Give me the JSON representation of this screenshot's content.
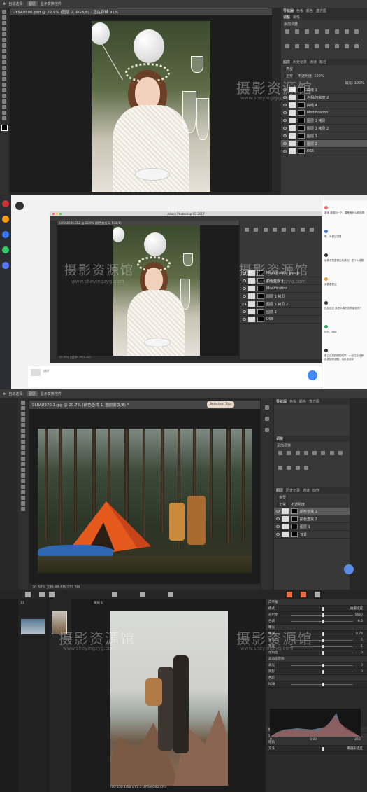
{
  "panel1": {
    "options_bar": {
      "auto_select": "自动选择:",
      "layer": "图层",
      "show_transform": "显示变换控件"
    },
    "doc_tab": "UY5A0506.psd @ 22.9% (图层 2, RGB/8) - 正在存储 91%",
    "panel_tabs": [
      "导航器",
      "色板",
      "颜色",
      "直方图"
    ],
    "adjust_tabs": [
      "调整",
      "属性"
    ],
    "add_adjust": "添加调整",
    "layers_tabs": [
      "图层",
      "历史记录",
      "通道",
      "路径"
    ],
    "kind": "类型",
    "blend": "正常",
    "opacity": "不透明度: 100%",
    "fill": "填充: 100%",
    "layers": [
      {
        "name": "曲线 1",
        "selected": false
      },
      {
        "name": "色相/饱和度 2",
        "selected": false
      },
      {
        "name": "曲线 4",
        "selected": false
      },
      {
        "name": "Modification",
        "selected": false
      },
      {
        "name": "图层 1 拷贝",
        "selected": false
      },
      {
        "name": "图层 1 拷贝 2",
        "selected": false
      },
      {
        "name": "图层 1",
        "selected": false
      },
      {
        "name": "图层 2",
        "selected": true
      },
      {
        "name": "DS5",
        "selected": false
      }
    ]
  },
  "panel2": {
    "app_title": "Adobe Photoshop CC 2017",
    "doc_tab": "UY5A0506.CR2 @ 22.9% (颜色查找 1, RGB/8)",
    "layers": [
      {
        "name": "Modification group"
      },
      {
        "name": "颜色查找 1"
      },
      {
        "name": "Modification"
      },
      {
        "name": "图层 1 拷贝"
      },
      {
        "name": "图层 1 拷贝 2"
      },
      {
        "name": "图层 1"
      },
      {
        "name": "DS5"
      }
    ],
    "status": "22.93%    文档:64.1M/1.10G",
    "chat": [
      {
        "text": "老师 我想问一下，要是有什么颜色啊"
      },
      {
        "text": "嗯，我们试试看"
      },
      {
        "text": "后期不是要调出效果吗？是什么效果"
      },
      {
        "text": "我要看看这"
      },
      {
        "text": "比如这张 要怎么调出这种感觉吗？"
      },
      {
        "text": "好的，继续"
      },
      {
        "text": "看过这段视频的同学，一起讨论这种色调如何调整，请私信老师"
      }
    ],
    "input_hint": "讲讲"
  },
  "panel3": {
    "options_bar": {
      "auto_select": "自动选择:",
      "layer": "图层",
      "show_transform": "显示变换控件"
    },
    "doc_tab": "9L8A8970.1.jpg @ 20.7% (颜色查找 1, 图层蒙版/8) *",
    "floating_tab": "Selection Tool",
    "panel_tabs": [
      "导航器",
      "色板",
      "颜色",
      "直方图"
    ],
    "adjust_tabs": [
      "调整"
    ],
    "add_adjust": "添加调整",
    "layers_tabs": [
      "图层",
      "历史记录",
      "通道",
      "动作"
    ],
    "kind": "类型",
    "blend": "正常",
    "opacity": "不透明度",
    "layers": [
      {
        "name": "颜色查找 1",
        "selected": true
      },
      {
        "name": "颜色查找 2",
        "selected": false
      },
      {
        "name": "图层 1",
        "selected": false
      },
      {
        "name": "背景",
        "selected": false
      }
    ],
    "status": "20.68%    文档:88.6M/177.3M"
  },
  "panel4": {
    "browser_count": "11",
    "layer_label": "图层 1",
    "sections": [
      {
        "title": "白平衡",
        "rows": [
          {
            "label": "模式",
            "value": "拍摄设置"
          },
          {
            "label": "开尔文",
            "value": "5660"
          },
          {
            "label": "色调",
            "value": "-6.6"
          }
        ]
      },
      {
        "title": "曝光",
        "rows": [
          {
            "label": "曝光",
            "value": "0.74"
          },
          {
            "label": "对比度",
            "value": "5"
          },
          {
            "label": "亮度",
            "value": "-1"
          },
          {
            "label": "饱和度",
            "value": "0"
          }
        ]
      },
      {
        "title": "高动态范围",
        "rows": [
          {
            "label": "高光",
            "value": "0"
          },
          {
            "label": "阴影",
            "value": "0"
          }
        ]
      },
      {
        "title": "色阶",
        "rows": [
          {
            "label": "RGB",
            "value": ""
          }
        ]
      },
      {
        "title": "曲线",
        "rows": []
      },
      {
        "title": "清晰度",
        "rows": []
      },
      {
        "title": "暗角",
        "rows": [
          {
            "label": "方法",
            "value": "椭圆形选区"
          }
        ]
      }
    ],
    "level_vals": {
      "low": "0",
      "mid": "0.00",
      "high": "255"
    },
    "status": "ISO 250    1/50 s    f/2.2    UY5A0282.CR3"
  },
  "watermark": {
    "cn": "摄影资源馆",
    "url": "www.sheyingzyg.com"
  }
}
